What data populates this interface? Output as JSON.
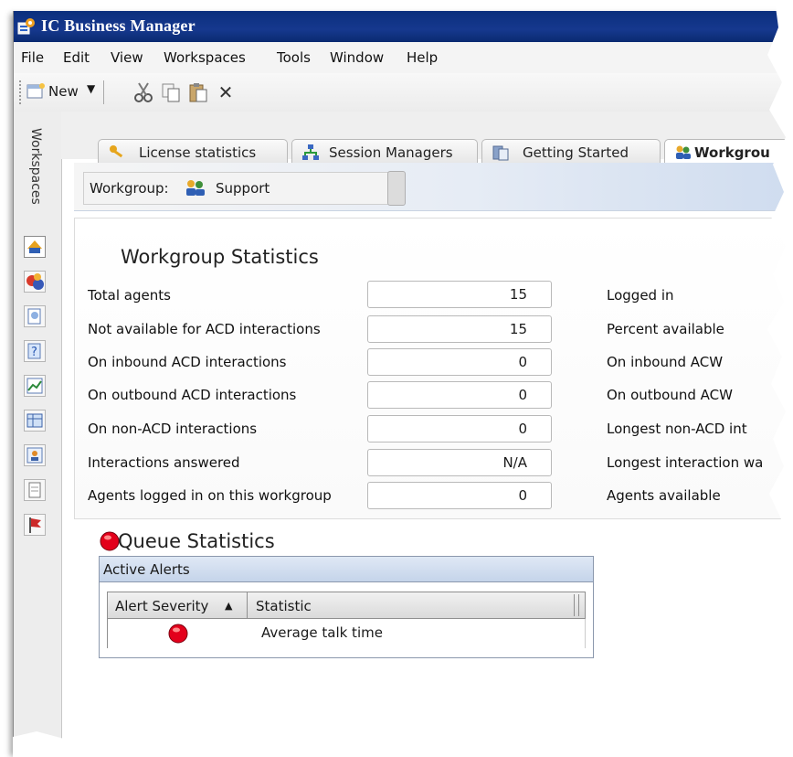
{
  "app": {
    "title": "IC Business Manager"
  },
  "menu": [
    "File",
    "Edit",
    "View",
    "Workspaces",
    "Tools",
    "Window",
    "Help"
  ],
  "toolbar": {
    "new_label": "New",
    "cut_icon": "cut-icon",
    "copy_icon": "copy-icon",
    "paste_icon": "paste-icon",
    "delete_icon": "delete-icon",
    "delete_glyph": "✕"
  },
  "sidebar": {
    "label": "Workspaces",
    "icons": [
      "workgroup-icon",
      "users-icon",
      "reports-icon",
      "help-icon",
      "chart-icon",
      "table-icon",
      "schedule-icon",
      "document-icon",
      "flag-icon"
    ]
  },
  "tabs": [
    {
      "label": "License statistics"
    },
    {
      "label": "Session Managers"
    },
    {
      "label": "Getting Started"
    },
    {
      "label": "Workgrou"
    }
  ],
  "workgroup": {
    "label": "Workgroup:",
    "value": "Support"
  },
  "stats": {
    "title": "Workgroup Statistics",
    "rows": [
      {
        "label": "Total agents",
        "value": "15",
        "right_label": "Logged in"
      },
      {
        "label": "Not available for ACD interactions",
        "value": "15",
        "right_label": "Percent available"
      },
      {
        "label": "On inbound ACD interactions",
        "value": "0",
        "right_label": "On inbound ACW"
      },
      {
        "label": "On outbound ACD interactions",
        "value": "0",
        "right_label": "On outbound ACW"
      },
      {
        "label": "On non-ACD interactions",
        "value": "0",
        "right_label": "Longest non-ACD int"
      },
      {
        "label": "Interactions answered",
        "value": "N/A",
        "right_label": "Longest interaction wa"
      },
      {
        "label": "Agents logged in on this workgroup",
        "value": "0",
        "right_label": "Agents available"
      }
    ]
  },
  "queue": {
    "title": "Queue Statistics",
    "alerts_title": "Active Alerts",
    "columns": [
      "Alert Severity",
      "Statistic"
    ],
    "sort_glyph": "▲",
    "rows": [
      {
        "severity_icon": "red-alert-icon",
        "statistic": "Average talk time"
      }
    ]
  },
  "colors": {
    "titlebar": "#16388e",
    "alert_red": "#e3001b",
    "header_blue": "#cfdcef"
  }
}
